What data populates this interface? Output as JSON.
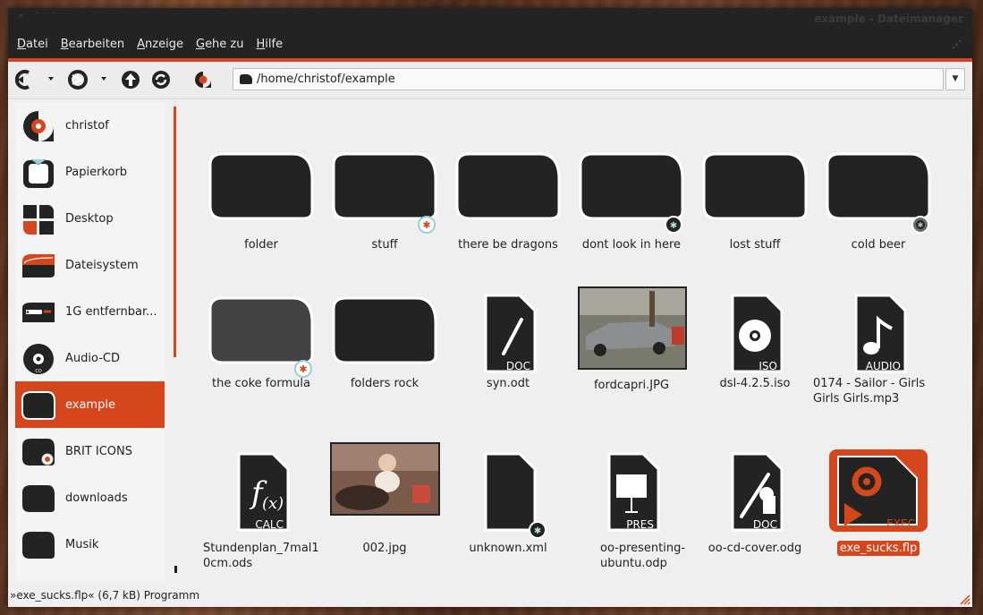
{
  "window": {
    "title": "example - Dateimanager"
  },
  "menu": [
    {
      "label": "Datei"
    },
    {
      "label": "Bearbeiten"
    },
    {
      "label": "Anzeige"
    },
    {
      "label": "Gehe zu"
    },
    {
      "label": "Hilfe"
    }
  ],
  "toolbar": {
    "path": "/home/christof/example",
    "icons": [
      "back-icon",
      "forward-icon",
      "up-icon",
      "reload-icon",
      "home-icon"
    ]
  },
  "sidebar": {
    "items": [
      {
        "label": "christof",
        "icon": "home-icon"
      },
      {
        "label": "Papierkorb",
        "icon": "trash-icon"
      },
      {
        "label": "Desktop",
        "icon": "desktop-icon"
      },
      {
        "label": "Dateisystem",
        "icon": "filesystem-icon"
      },
      {
        "label": "1G entfernbar...",
        "icon": "usb-drive-icon"
      },
      {
        "label": "Audio-CD",
        "icon": "cd-icon"
      },
      {
        "label": "example",
        "icon": "folder-icon",
        "active": true
      },
      {
        "label": "BRIT ICONS",
        "icon": "folder-icon"
      },
      {
        "label": "downloads",
        "icon": "folder-icon"
      },
      {
        "label": "Musik",
        "icon": "folder-icon"
      }
    ]
  },
  "files": [
    {
      "label": "folder",
      "type": "folder"
    },
    {
      "label": "stuff",
      "type": "folder",
      "emblem": "light"
    },
    {
      "label": "there be dragons",
      "type": "folder"
    },
    {
      "label": "dont look in here",
      "type": "folder",
      "emblem": "dark"
    },
    {
      "label": "lost stuff",
      "type": "folder"
    },
    {
      "label": "cold beer",
      "type": "folder",
      "emblem": "darkring"
    },
    {
      "label": "the coke formula",
      "type": "folder-gray",
      "emblem": "light"
    },
    {
      "label": "folders rock",
      "type": "folder"
    },
    {
      "label": "syn.odt",
      "type": "doc",
      "tag": "DOC"
    },
    {
      "label": "fordcapri.JPG",
      "type": "photo-car"
    },
    {
      "label": "dsl-4.2.5.iso",
      "type": "iso",
      "tag": "ISO"
    },
    {
      "label": "0174 - Sailor - Girls Girls Girls.mp3",
      "type": "audio",
      "tag": "AUDIO"
    },
    {
      "label": "Stundenplan_7mal10cm.ods",
      "type": "calc",
      "tag": "CALC"
    },
    {
      "label": "002.jpg",
      "type": "photo-baby"
    },
    {
      "label": "unknown.xml",
      "type": "blank",
      "emblem": "dark"
    },
    {
      "label": "oo-presenting-ubuntu.odp",
      "type": "pres",
      "tag": "PRES"
    },
    {
      "label": "oo-cd-cover.odg",
      "type": "draw",
      "tag": "DOC"
    },
    {
      "label": "exe_sucks.flp",
      "type": "exec",
      "tag": "EXEC",
      "selected": true
    }
  ],
  "status": {
    "text": "»exe_sucks.flp« (6,7 kB) Programm"
  },
  "colors": {
    "accent": "#d5461d",
    "dark": "#232324",
    "bg": "#efefef"
  }
}
